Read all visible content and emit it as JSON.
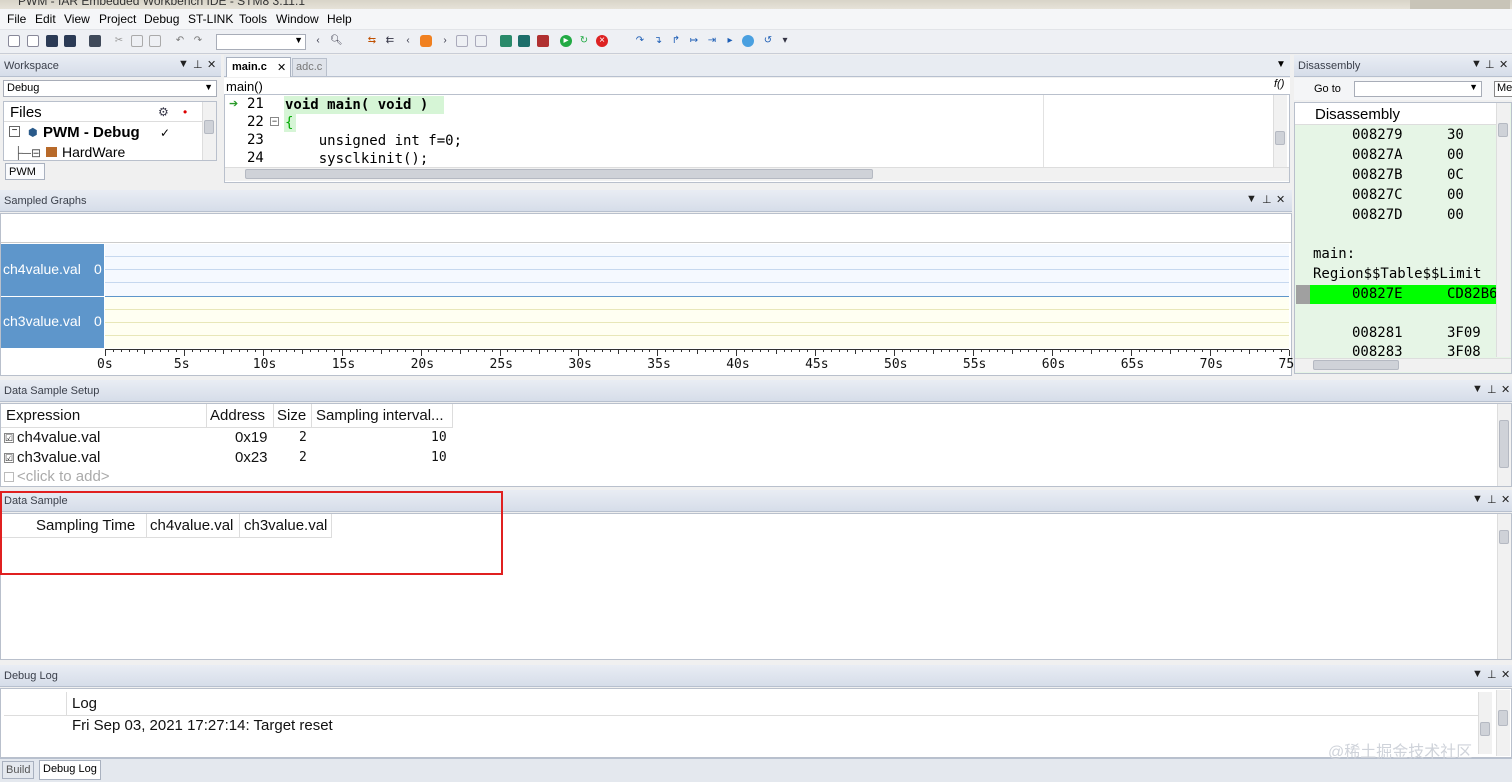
{
  "window": {
    "title": "PWM - IAR Embedded Workbench IDE - STM8 3.11.1"
  },
  "menu": [
    "File",
    "Edit",
    "View",
    "Project",
    "Debug",
    "ST-LINK",
    "Tools",
    "Window",
    "Help"
  ],
  "workspace": {
    "title": "Workspace",
    "config": "Debug",
    "files_header": "Files",
    "project": "PWM - Debug",
    "check": "✓",
    "folder": "HardWare",
    "tab": "PWM"
  },
  "editor": {
    "tabs": [
      "main.c",
      "adc.c"
    ],
    "func_combo": "main()",
    "func_icon": "f()",
    "lines": [
      {
        "num": "21",
        "code": "void main( void )"
      },
      {
        "num": "22",
        "code": "{"
      },
      {
        "num": "23",
        "code": "    unsigned int f=0;"
      },
      {
        "num": "24",
        "code": "    sysclkinit();"
      }
    ]
  },
  "disassembly": {
    "title": "Disassembly",
    "goto_label": "Go to",
    "mem_button": "Me",
    "header": "Disassembly",
    "rows_top": [
      {
        "addr": "008279",
        "val": "30"
      },
      {
        "addr": "00827A",
        "val": "00"
      },
      {
        "addr": "00827B",
        "val": "0C"
      },
      {
        "addr": "00827C",
        "val": "00"
      },
      {
        "addr": "00827D",
        "val": "00"
      }
    ],
    "label1": "main:",
    "label2": "Region$$Table$$Limit",
    "current": {
      "addr": "00827E",
      "val": "CD82B6"
    },
    "rows_bottom": [
      {
        "addr": "008281",
        "val": "3F09"
      },
      {
        "addr": "008283",
        "val": "3F08"
      }
    ]
  },
  "sampled_graphs": {
    "title": "Sampled Graphs",
    "channels": [
      {
        "name": "ch4value.val",
        "value": "0"
      },
      {
        "name": "ch3value.val",
        "value": "0"
      }
    ],
    "time_labels": [
      "0s",
      "5s",
      "10s",
      "15s",
      "20s",
      "25s",
      "30s",
      "35s",
      "40s",
      "45s",
      "50s",
      "55s",
      "60s",
      "65s",
      "70s",
      "75"
    ]
  },
  "data_sample_setup": {
    "title": "Data Sample Setup",
    "columns": [
      "Expression",
      "Address",
      "Size",
      "Sampling interval..."
    ],
    "rows": [
      {
        "check": "☑",
        "expr": "ch4value.val",
        "addr": "0x19",
        "size": "2",
        "interval": "10"
      },
      {
        "check": "☑",
        "expr": "ch3value.val",
        "addr": "0x23",
        "size": "2",
        "interval": "10"
      }
    ],
    "add_placeholder": "<click to add>"
  },
  "data_sample": {
    "title": "Data Sample",
    "columns": [
      "Sampling Time",
      "ch4value.val",
      "ch3value.val"
    ],
    "highlight_color": "#e02020"
  },
  "debug_log": {
    "title": "Debug Log",
    "column": "Log",
    "entries": [
      "Fri Sep 03, 2021 17:27:14: Target reset"
    ]
  },
  "bottom_tabs": [
    "Build",
    "Debug Log"
  ],
  "watermark": "@稀土掘金技术社区",
  "colors": {
    "graph_label_bg": "#5e96cb",
    "current_line": "#00ff00",
    "disasm_bg": "#e6f5e6",
    "highlight": "#e02020"
  }
}
